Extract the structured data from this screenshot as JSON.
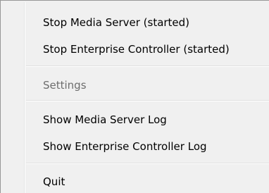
{
  "menu": {
    "items": [
      {
        "label": "Stop Media Server (started)",
        "enabled": true
      },
      {
        "label": "Stop Enterprise Controller (started)",
        "enabled": true
      },
      {
        "label": "Settings",
        "enabled": false
      },
      {
        "label": "Show Media Server Log",
        "enabled": true
      },
      {
        "label": "Show Enterprise Controller Log",
        "enabled": true
      },
      {
        "label": "Quit",
        "enabled": true
      }
    ]
  }
}
